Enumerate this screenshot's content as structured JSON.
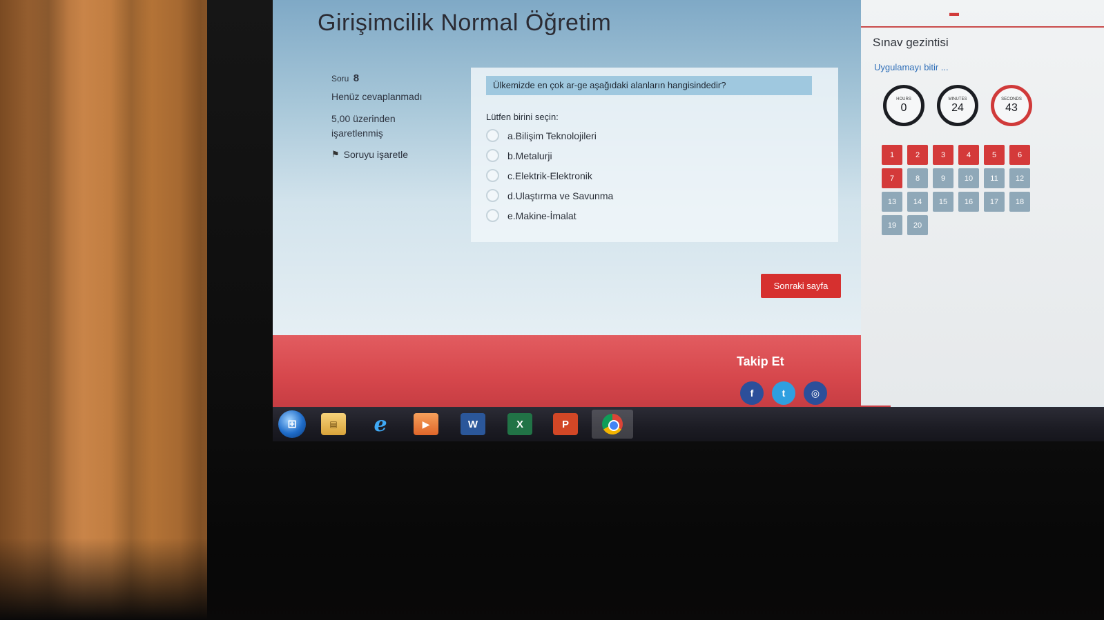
{
  "course": {
    "title": "Girişimcilik Normal Öğretim"
  },
  "question_info": {
    "soru_label": "Soru",
    "soru_number": "8",
    "state": "Henüz cevaplanmadı",
    "marked_out_of": "5,00 üzerinden işaretlenmiş",
    "flag_label": "Soruyu işaretle"
  },
  "question": {
    "text": "Ülkemizde en çok ar-ge aşağıdaki alanların hangisindedir?",
    "prompt": "Lütfen birini seçin:",
    "answers": [
      "a.Bilişim Teknolojileri",
      "b.Metalurji",
      "c.Elektrik-Elektronik",
      "d.Ulaştırma ve Savunma",
      "e.Makine-İmalat"
    ]
  },
  "next_button": "Sonraki sayfa",
  "footer": {
    "follow_label": "Takip Et",
    "socials": [
      "f",
      "t",
      "◎"
    ]
  },
  "sidebar": {
    "menu_icon": "hamburger-icon",
    "title": "Sınav gezintisi",
    "finish_link": "Uygulamayı bitir ...",
    "timer": {
      "hours_label": "HOURS",
      "hours": "0",
      "minutes_label": "MINUTES",
      "minutes": "24",
      "seconds_label": "SECONDS",
      "seconds": "43"
    },
    "questions": [
      "1",
      "2",
      "3",
      "4",
      "5",
      "6",
      "7",
      "8",
      "9",
      "10",
      "11",
      "12",
      "13",
      "14",
      "15",
      "16",
      "17",
      "18",
      "19",
      "20"
    ],
    "answered_count": 7
  },
  "taskbar": {
    "apps": [
      "start-orb",
      "file-explorer",
      "internet-explorer",
      "media-player",
      "word",
      "excel",
      "powerpoint",
      "chrome"
    ],
    "word_letter": "W",
    "excel_letter": "X",
    "ppt_letter": "P"
  },
  "colors": {
    "accent_red": "#d6302f",
    "footer_red": "#d6474c",
    "pending_grey": "#8fa8b8",
    "link_blue": "#2f6fb8"
  }
}
